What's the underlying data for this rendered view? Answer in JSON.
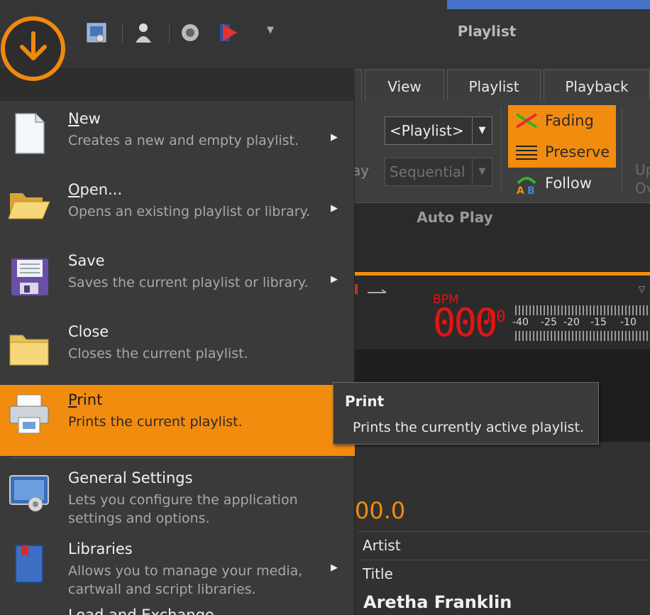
{
  "window": {
    "title": "Playlist"
  },
  "ribbon": {
    "tabs": [
      {
        "label": "View"
      },
      {
        "label": "Playlist"
      },
      {
        "label": "Playback"
      }
    ],
    "playlist_combo": "<Playlist>",
    "order_combo": "Sequential",
    "fading_label": "Fading",
    "preserve_label": "Preserve",
    "follow_label": "Follow",
    "group_label": "Auto Play",
    "cut_label_left": "ay",
    "cut_label_right_1": "Up",
    "cut_label_right_2": "Ov"
  },
  "meters": {
    "bpm_label": "BPM",
    "bpm_value": "000",
    "bpm_fraction": "00",
    "scale": [
      "-40",
      "-25",
      "-20",
      "-15",
      "-10"
    ]
  },
  "player": {
    "time": "00.0",
    "artist_label": "Artist",
    "title_label": "Title",
    "artist_value": "Aretha Franklin"
  },
  "app_menu": {
    "items": [
      {
        "title": "New",
        "mnemonic": "N",
        "rest": "ew",
        "desc": "Creates a new and empty playlist.",
        "submenu": true,
        "icon": "new-document-icon"
      },
      {
        "title": "Open...",
        "mnemonic": "O",
        "rest": "pen...",
        "desc": "Opens an existing playlist or library.",
        "submenu": true,
        "icon": "open-folder-icon"
      },
      {
        "title": "Save",
        "mnemonic": "",
        "rest": "Save",
        "desc": "Saves the current playlist or library.",
        "submenu": true,
        "icon": "floppy-disk-icon"
      },
      {
        "title": "Close",
        "mnemonic": "",
        "rest": "Close",
        "desc": "Closes the current playlist.",
        "submenu": false,
        "icon": "folder-icon"
      },
      {
        "title": "Print",
        "mnemonic": "P",
        "rest": "rint",
        "desc": "Prints the current playlist.",
        "submenu": false,
        "icon": "printer-icon",
        "highlighted": true
      },
      {
        "title": "General Settings",
        "mnemonic": "",
        "rest": "General Settings",
        "desc": "Lets you configure the application settings and options.",
        "submenu": false,
        "icon": "settings-icon"
      },
      {
        "title": "Libraries",
        "mnemonic": "",
        "rest": "Libraries",
        "desc": "Allows you to manage your media, cartwall and script libraries.",
        "submenu": true,
        "icon": "library-book-icon"
      }
    ],
    "partial_item": "Load and Exchange"
  },
  "tooltip": {
    "title": "Print",
    "text": "Prints the currently active playlist."
  },
  "colors": {
    "accent": "#f28c0f",
    "bpm": "#e21414",
    "title_accent": "#4472c4"
  }
}
